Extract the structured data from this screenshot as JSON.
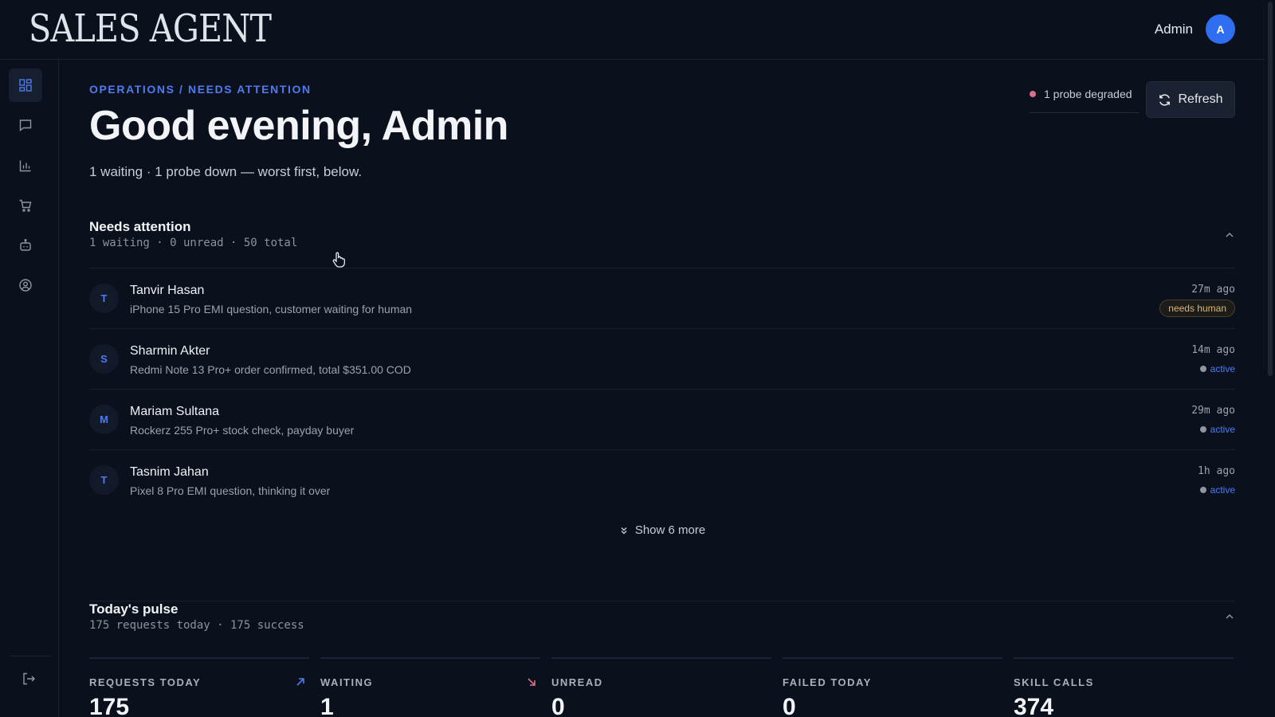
{
  "app": {
    "logo": "SALES AGENT"
  },
  "user": {
    "name": "Admin",
    "initial": "A"
  },
  "sidebar": {
    "items": [
      {
        "icon": "dashboard-icon",
        "active": true
      },
      {
        "icon": "chat-icon",
        "active": false
      },
      {
        "icon": "bar-chart-icon",
        "active": false
      },
      {
        "icon": "cart-icon",
        "active": false
      },
      {
        "icon": "bot-icon",
        "active": false
      },
      {
        "icon": "user-circle-icon",
        "active": false
      }
    ],
    "logout_icon": "logout-icon"
  },
  "header": {
    "breadcrumb": "OPERATIONS / NEEDS ATTENTION",
    "title": "Good evening, Admin",
    "subtitle": "1 waiting · 1 probe down — worst first, below.",
    "probe_status": "1 probe degraded",
    "refresh_label": "Refresh"
  },
  "needs_attention": {
    "title": "Needs attention",
    "meta": "1 waiting · 0 unread · 50 total",
    "rows": [
      {
        "initial": "T",
        "name": "Tanvir Hasan",
        "desc": "iPhone 15 Pro EMI question, customer waiting for human",
        "time": "27m ago",
        "status": "needs human",
        "kind": "needs"
      },
      {
        "initial": "S",
        "name": "Sharmin Akter",
        "desc": "Redmi Note 13 Pro+ order confirmed, total $351.00 COD",
        "time": "14m ago",
        "status": "active",
        "kind": "active"
      },
      {
        "initial": "M",
        "name": "Mariam Sultana",
        "desc": "Rockerz 255 Pro+ stock check, payday buyer",
        "time": "29m ago",
        "status": "active",
        "kind": "active"
      },
      {
        "initial": "T",
        "name": "Tasnim Jahan",
        "desc": "Pixel 8 Pro EMI question, thinking it over",
        "time": "1h ago",
        "status": "active",
        "kind": "active"
      }
    ],
    "show_more": "Show 6 more"
  },
  "pulse": {
    "title": "Today's pulse",
    "meta": "175 requests today · 175 success",
    "stats": [
      {
        "label": "REQUESTS TODAY",
        "value": "175",
        "trend": "up"
      },
      {
        "label": "WAITING",
        "value": "1",
        "trend": "down"
      },
      {
        "label": "UNREAD",
        "value": "0",
        "trend": ""
      },
      {
        "label": "FAILED TODAY",
        "value": "0",
        "trend": ""
      },
      {
        "label": "SKILL CALLS",
        "value": "374",
        "trend": ""
      }
    ]
  },
  "colors": {
    "background": "#0b111c",
    "accent": "#4f7bf0",
    "avatar": "#2f6ef0",
    "probe_dot": "#d9708a",
    "badge_needs": "#d8b779",
    "trend_up": "#4f7bf0",
    "trend_down": "#d9708a"
  }
}
